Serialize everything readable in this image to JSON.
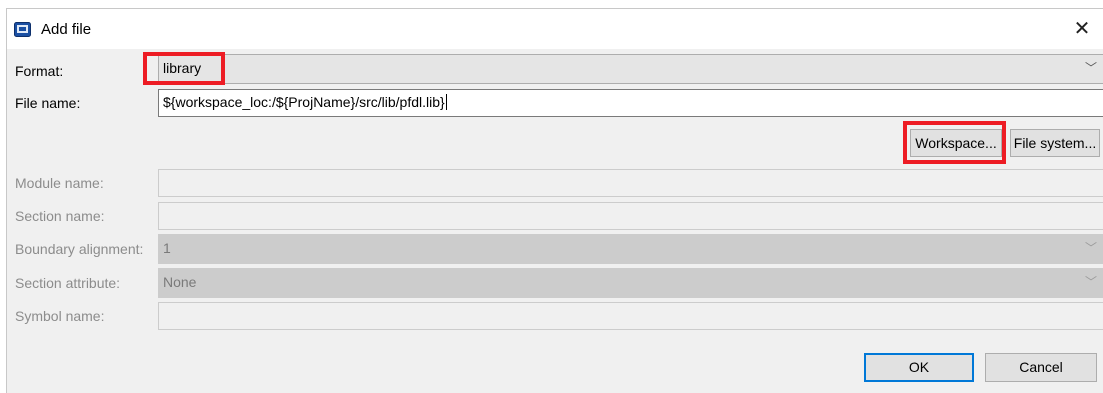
{
  "dialog": {
    "title": "Add file",
    "close_glyph": "✕"
  },
  "form": {
    "format": {
      "label": "Format:",
      "value": "library"
    },
    "file_name": {
      "label": "File name:",
      "value": "${workspace_loc:/${ProjName}/src/lib/pfdl.lib}"
    },
    "workspace_button": "Workspace...",
    "file_system_button": "File system...",
    "module_name": {
      "label": "Module name:",
      "value": ""
    },
    "section_name": {
      "label": "Section name:",
      "value": ""
    },
    "boundary_alignment": {
      "label": "Boundary alignment:",
      "value": "1"
    },
    "section_attribute": {
      "label": "Section attribute:",
      "value": "None"
    },
    "symbol_name": {
      "label": "Symbol name:",
      "value": ""
    }
  },
  "buttons": {
    "ok": "OK",
    "cancel": "Cancel"
  },
  "icons": {
    "app": "app-icon",
    "close": "close-icon",
    "dropdown": "chevron-down-icon"
  },
  "colors": {
    "highlight": "#ed1c24",
    "default_button_border": "#0078d7"
  }
}
